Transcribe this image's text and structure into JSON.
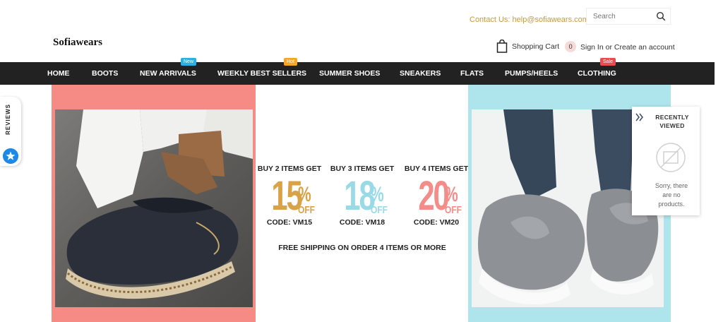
{
  "header": {
    "contact": "Contact Us: help@sofiawears.com",
    "search": {
      "placeholder": "Search"
    },
    "logo": "Sofiawears",
    "cart_label": "Shopping Cart",
    "cart_count": "0",
    "sign_in": "Sign In",
    "or": " or ",
    "create_account": "Create an account"
  },
  "nav": {
    "items": [
      {
        "label": "HOME"
      },
      {
        "label": "BOOTS"
      },
      {
        "label": "NEW ARRIVALS",
        "badge": "New"
      },
      {
        "label": "WEEKLY BEST SELLERS",
        "badge": "Hot"
      },
      {
        "label": "SUMMER SHOES"
      },
      {
        "label": "SNEAKERS"
      },
      {
        "label": "FLATS"
      },
      {
        "label": "PUMPS/HEELS"
      },
      {
        "label": "CLOTHING",
        "badge": "Sale"
      }
    ]
  },
  "reviews_tab": {
    "label": "REVIEWS"
  },
  "banner": {
    "offers": [
      {
        "buy": "BUY 2 ITEMS GET",
        "number": "15",
        "pct": "%",
        "off": "OFF",
        "code": "CODE: VM15",
        "color": "#d9a247"
      },
      {
        "buy": "BUY 3 ITEMS GET",
        "number": "18",
        "pct": "%",
        "off": "OFF",
        "code": "CODE: VM18",
        "color": "#9ad9e6"
      },
      {
        "buy": "BUY 4 ITEMS GET",
        "number": "20",
        "pct": "%",
        "off": "OFF",
        "code": "CODE: VM20",
        "color": "#f48c89"
      }
    ],
    "shipping": "FREE SHIPPING ON ORDER 4 ITEMS OR MORE",
    "left_bg": "#f68b86",
    "right_bg": "#aee4ec"
  },
  "recently_viewed": {
    "title": "RECENTLY VIEWED",
    "empty": "Sorry, there are no products."
  },
  "colors": {
    "nav_bg": "#222222",
    "accent_gold": "#c79a3d",
    "reviews_blue": "#1e88e5"
  }
}
